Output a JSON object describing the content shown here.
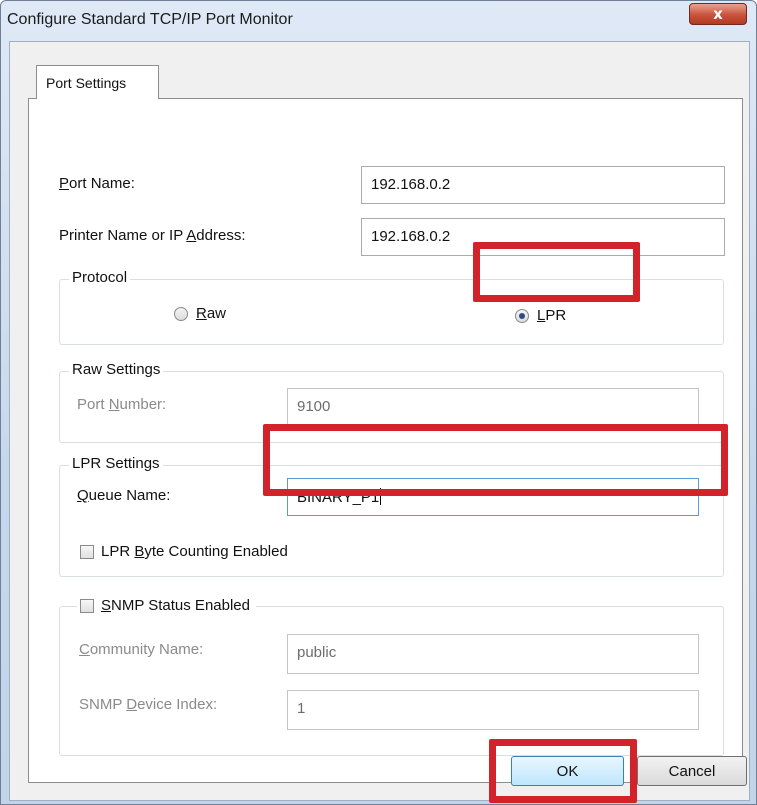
{
  "window": {
    "title": "Configure Standard TCP/IP Port Monitor",
    "close_glyph": "x"
  },
  "tabs": [
    {
      "label": "Port Settings"
    }
  ],
  "port_name": {
    "label_underlined": "P",
    "label_rest": "ort Name:",
    "value": "192.168.0.2"
  },
  "printer_name": {
    "label_pre": "Printer Name or IP ",
    "label_underlined": "A",
    "label_post": "ddress:",
    "value": "192.168.0.2"
  },
  "protocol": {
    "title": "Protocol",
    "options": [
      {
        "underlined": "R",
        "rest": "aw",
        "selected": false
      },
      {
        "underlined": "L",
        "rest": "PR",
        "selected": true
      }
    ]
  },
  "raw_settings": {
    "title": "Raw Settings",
    "port_number_pre": "Port ",
    "port_number_underlined": "N",
    "port_number_post": "umber:",
    "port_number_value": "9100"
  },
  "lpr_settings": {
    "title": "LPR Settings",
    "queue_underlined": "Q",
    "queue_rest": "ueue Name:",
    "queue_value": "BINARY_P1",
    "byte_counting_pre": "LPR ",
    "byte_counting_underlined": "B",
    "byte_counting_post": "yte Counting Enabled",
    "byte_counting_checked": false
  },
  "snmp": {
    "status_underlined": "S",
    "status_rest": "NMP Status Enabled",
    "status_checked": false,
    "community_underlined": "C",
    "community_rest": "ommunity Name:",
    "community_value": "public",
    "device_index_pre": "SNMP ",
    "device_index_underlined": "D",
    "device_index_post": "evice Index:",
    "device_index_value": "1"
  },
  "buttons": {
    "ok": "OK",
    "cancel": "Cancel"
  },
  "colors": {
    "highlight": "#d2232a",
    "accent": "#3c7fb1"
  }
}
